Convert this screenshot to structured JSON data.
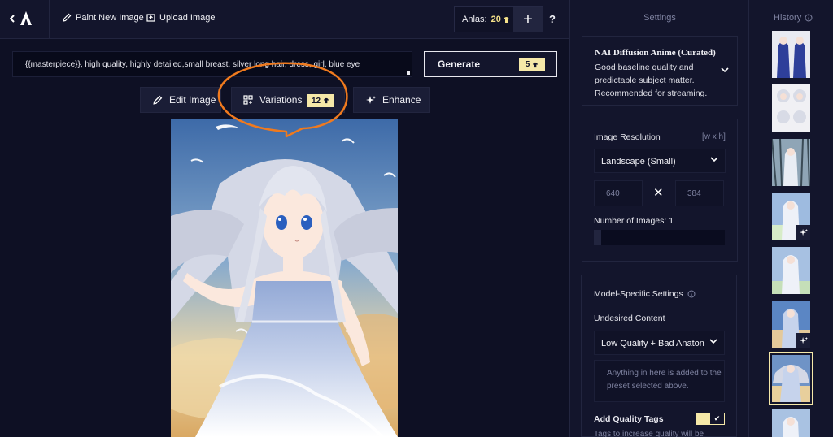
{
  "topbar": {
    "paint_label": "Paint New Image",
    "upload_label": "Upload Image",
    "anlas_label": "Anlas:",
    "anlas_value": "20",
    "plus_label": "+",
    "help_label": "?"
  },
  "prompt": {
    "text": "{{masterpiece}}, high quality, highly detailed,small breast, silver long hair, dress, girl, blue eye"
  },
  "generate": {
    "label": "Generate",
    "cost": "5"
  },
  "actions": {
    "edit_label": "Edit Image",
    "variations_label": "Variations",
    "variations_cost": "12",
    "enhance_label": "Enhance"
  },
  "settings": {
    "title": "Settings",
    "model": {
      "name": "NAI Diffusion Anime (Curated)",
      "description": "Good baseline quality and predictable subject matter. Recommended for streaming."
    },
    "resolution": {
      "label": "Image Resolution",
      "hint": "[w x h]",
      "preset": "Landscape (Small)",
      "width": "640",
      "height": "384",
      "times": "✕"
    },
    "num_images": {
      "label": "Number of Images:",
      "value": "1"
    },
    "model_specific": {
      "label": "Model-Specific Settings"
    },
    "undesired": {
      "label": "Undesired Content",
      "preset": "Low Quality + Bad Anaton",
      "placeholder": "Anything in here is added to the preset selected above."
    },
    "quality_tags": {
      "label": "Add Quality Tags",
      "enabled": true,
      "check": "✔",
      "desc": "Tags to increase quality will be"
    }
  },
  "history": {
    "title": "History"
  },
  "colors": {
    "background": "#0e1024",
    "panel": "#13152c",
    "accent": "#f5e8a8",
    "annotation": "#f07a1e"
  }
}
